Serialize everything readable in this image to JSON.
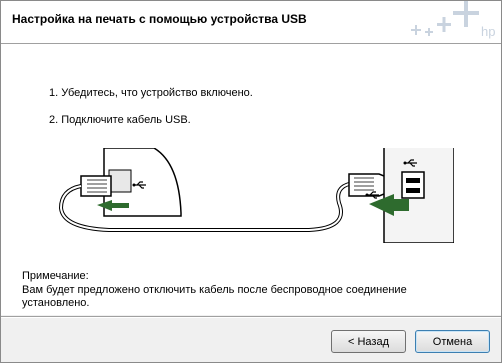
{
  "header": {
    "title": "Настройка на печать с помощью устройства USB",
    "logo_text": "hp"
  },
  "steps": [
    "1. Убедитесь, что устройство включено.",
    "2. Подключите кабель USB."
  ],
  "illustration": {
    "usb_icon": "usb-icon",
    "arrow_color": "#2e6b2e"
  },
  "note": {
    "label": "Примечание:",
    "text": "Вам будет предложено отключить кабель после беспроводное соединение установлено."
  },
  "buttons": {
    "back": "< Назад",
    "cancel": "Отмена"
  }
}
